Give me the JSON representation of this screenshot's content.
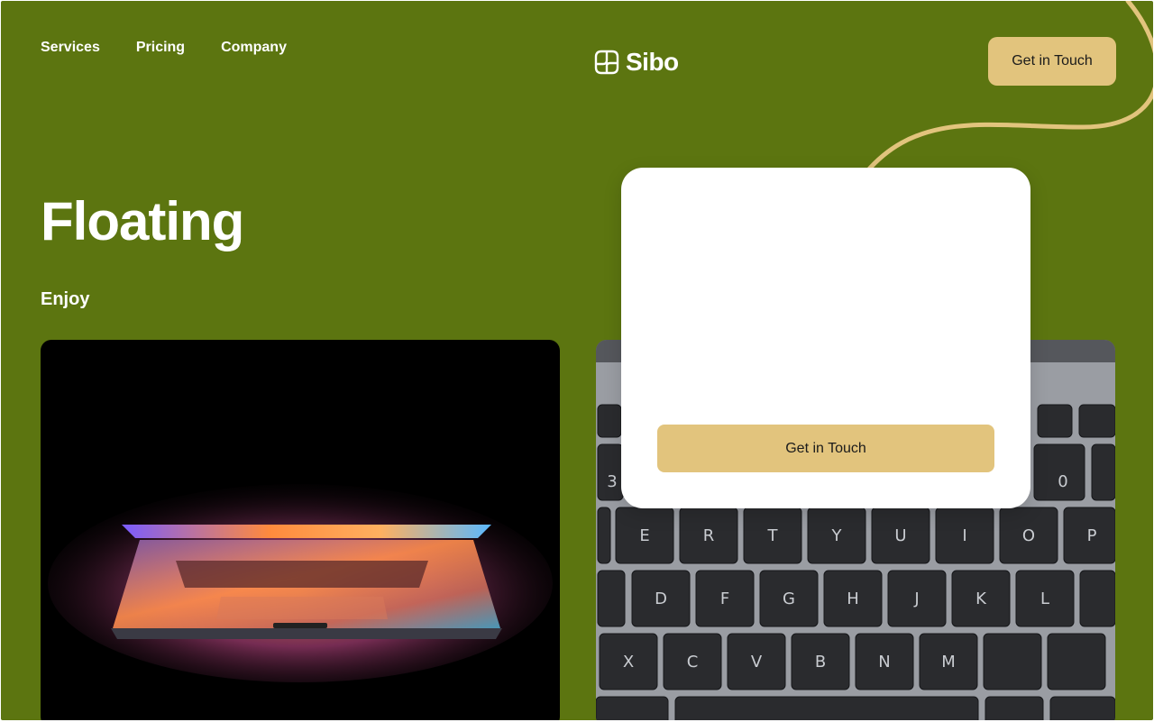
{
  "nav": {
    "items": [
      {
        "label": "Services"
      },
      {
        "label": "Pricing"
      },
      {
        "label": "Company"
      }
    ]
  },
  "logo": {
    "text": "Sibo",
    "icon": "sibo-logo-icon"
  },
  "header": {
    "cta_label": "Get in Touch"
  },
  "hero": {
    "title": "Floating",
    "subtitle": "Enjoy"
  },
  "modal": {
    "cta_label": "Get in Touch"
  },
  "colors": {
    "background": "#5c7510",
    "accent": "#e2c47d",
    "text": "#ffffff"
  }
}
